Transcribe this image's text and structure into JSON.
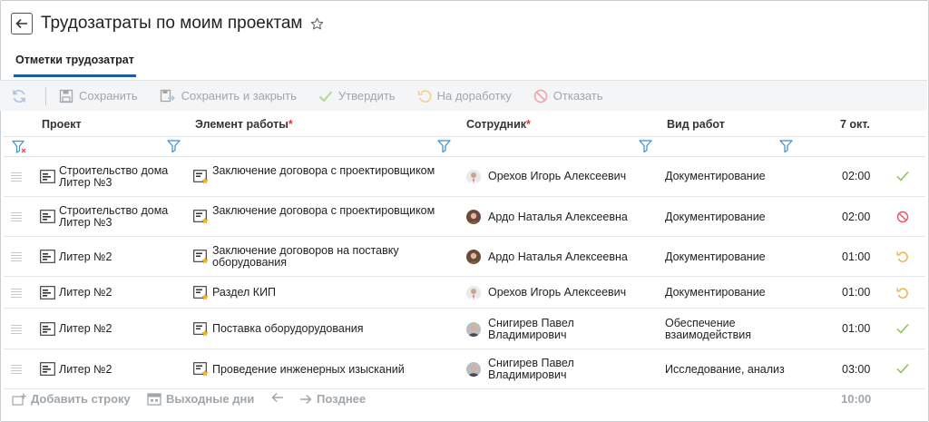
{
  "header": {
    "title": "Трудозатраты по моим проектам"
  },
  "tabs": [
    {
      "label": "Отметки трудозатрат",
      "active": true
    }
  ],
  "toolbar": {
    "save": "Сохранить",
    "save_close": "Сохранить и закрыть",
    "approve": "Утвердить",
    "rework": "На доработку",
    "reject": "Отказать"
  },
  "columns": {
    "project": "Проект",
    "work_item": "Элемент работы",
    "employee": "Сотрудник",
    "work_type": "Вид работ",
    "date": "7 окт.",
    "required_mark": "*"
  },
  "rows": [
    {
      "project": [
        "Строительство дома",
        "Литер №3"
      ],
      "work_item": [
        "Заключение договора с проектировщиком"
      ],
      "employee": [
        "Орехов Игорь Алексеевич"
      ],
      "work_type": [
        "Документирование"
      ],
      "hours": "02:00",
      "status": "approved"
    },
    {
      "project": [
        "Строительство дома",
        "Литер №3"
      ],
      "work_item": [
        "Заключение договора с проектировщиком"
      ],
      "employee": [
        "Ардо Наталья Алексеевна"
      ],
      "work_type": [
        "Документирование"
      ],
      "hours": "02:00",
      "status": "rejected"
    },
    {
      "project": [
        "Литер №2"
      ],
      "work_item": [
        "Заключение договоров на поставку",
        "оборудования"
      ],
      "employee": [
        "Ардо Наталья Алексеевна"
      ],
      "work_type": [
        "Документирование"
      ],
      "hours": "01:00",
      "status": "rework"
    },
    {
      "project": [
        "Литер №2"
      ],
      "work_item": [
        "Раздел КИП"
      ],
      "employee": [
        "Орехов Игорь Алексеевич"
      ],
      "work_type": [
        "Документирование"
      ],
      "hours": "01:00",
      "status": "rework"
    },
    {
      "project": [
        "Литер №2"
      ],
      "work_item": [
        "Поставка оборудорудования"
      ],
      "employee": [
        "Снигирев Павел",
        "Владимирович"
      ],
      "work_type": [
        "Обеспечение",
        "взаимодействия"
      ],
      "hours": "01:00",
      "status": "approved"
    },
    {
      "project": [
        "Литер №2"
      ],
      "work_item": [
        "Проведение инженерных изысканий"
      ],
      "employee": [
        "Снигирев Павел",
        "Владимирович"
      ],
      "work_type": [
        "Исследование, анализ"
      ],
      "hours": "03:00",
      "status": "approved"
    }
  ],
  "footer": {
    "add_row": "Добавить строку",
    "days_off": "Выходные дни",
    "later": "Позднее",
    "total": "10:00"
  },
  "colors": {
    "accent": "#1c5ca8",
    "approved": "#8cc152",
    "rejected": "#e8555d",
    "rework": "#e8b04a",
    "disabled": "#a0a6ac",
    "filter": "#3a8fd0"
  }
}
